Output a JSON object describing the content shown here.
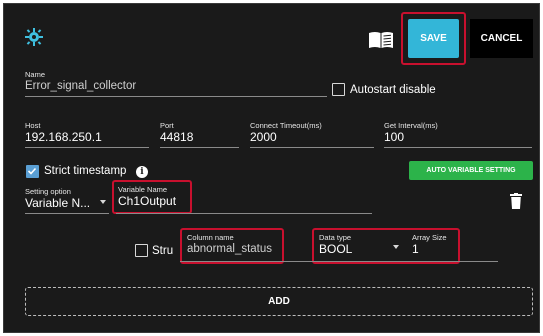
{
  "toolbar": {
    "icon_left": "bug-gear-icon",
    "icon_book": "book-icon",
    "save_label": "SAVE",
    "cancel_label": "CANCEL"
  },
  "name": {
    "label": "Name",
    "value": "Error_signal_collector"
  },
  "autostart": {
    "label": "Autostart disable",
    "checked": false
  },
  "host": {
    "label": "Host",
    "value": "192.168.250.1"
  },
  "port": {
    "label": "Port",
    "value": "44818"
  },
  "connect_timeout": {
    "label": "Connect Timeout(ms)",
    "value": "2000"
  },
  "get_interval": {
    "label": "Get Interval(ms)",
    "value": "100"
  },
  "strict_timestamp": {
    "label": "Strict timestamp",
    "checked": true,
    "info_icon": "info-icon"
  },
  "auto_variable_button": "AUTO VARIABLE SETTING",
  "setting_option": {
    "label": "Setting option",
    "value": "Variable N..."
  },
  "variable_name": {
    "label": "Variable Name",
    "value": "Ch1Output"
  },
  "delete_icon": "trash-icon",
  "struct": {
    "label": "Stru",
    "checked": false
  },
  "column_name": {
    "label": "Column name",
    "value": "abnormal_status"
  },
  "data_type": {
    "label": "Data type",
    "value": "BOOL"
  },
  "array_size": {
    "label": "Array Size",
    "value": "1"
  },
  "add_label": "ADD",
  "colors": {
    "save": "#33b6d8",
    "green": "#2cb34a",
    "highlight": "#c8102e",
    "background": "#1a1a1a"
  }
}
